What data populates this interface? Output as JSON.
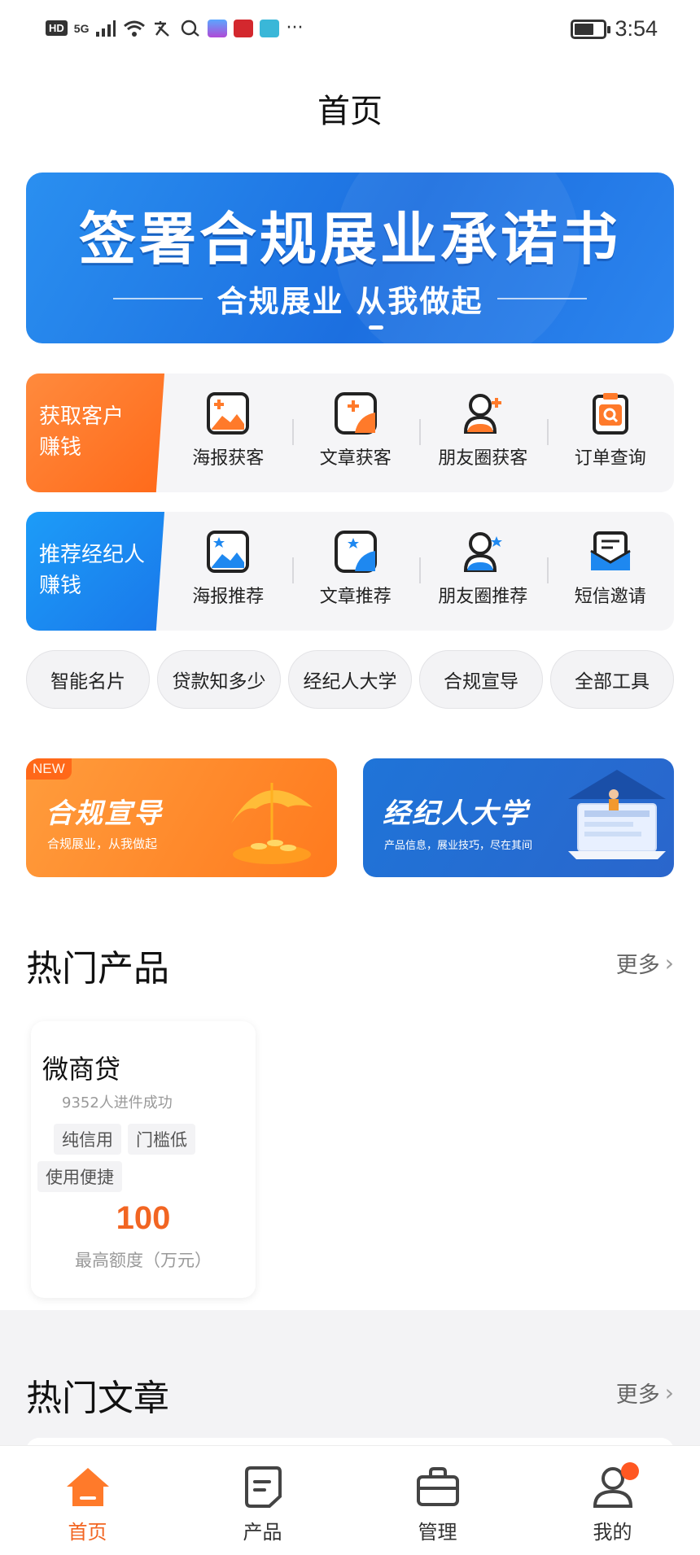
{
  "status_bar": {
    "hd": "HD",
    "network": "5G",
    "time": "3:54",
    "icons": [
      "signal-icon",
      "wifi-icon",
      "translate-icon",
      "chat-icon",
      "app-icon",
      "app-icon",
      "app-icon",
      "more-icon"
    ]
  },
  "nav": {
    "title": "首页"
  },
  "banner": {
    "title": "签署合规展业承诺书",
    "subtitle": "合规展业 从我做起"
  },
  "acquire_row": {
    "label_line1": "获取客户",
    "label_line2": "赚钱",
    "items": [
      {
        "label": "海报获客",
        "icon": "poster-icon"
      },
      {
        "label": "文章获客",
        "icon": "article-icon"
      },
      {
        "label": "朋友圈获客",
        "icon": "moments-icon"
      },
      {
        "label": "订单查询",
        "icon": "order-search-icon"
      }
    ]
  },
  "recommend_row": {
    "label_line1": "推荐经纪人",
    "label_line2": "赚钱",
    "items": [
      {
        "label": "海报推荐",
        "icon": "poster-icon"
      },
      {
        "label": "文章推荐",
        "icon": "article-icon"
      },
      {
        "label": "朋友圈推荐",
        "icon": "moments-icon"
      },
      {
        "label": "短信邀请",
        "icon": "sms-icon"
      }
    ]
  },
  "chips": [
    "智能名片",
    "贷款知多少",
    "经纪人大学",
    "合规宣导",
    "全部工具"
  ],
  "promos": {
    "compliance": {
      "tag": "NEW",
      "title": "合规宣导",
      "subtitle": "合规展业，从我做起"
    },
    "university": {
      "title": "经纪人大学",
      "subtitle": "产品信息，展业技巧，尽在其间"
    }
  },
  "hot_products": {
    "title": "热门产品",
    "more": "更多",
    "items": [
      {
        "name": "微商贷",
        "stat": "9352人进件成功",
        "tags": [
          "纯信用",
          "门槛低",
          "使用便捷"
        ],
        "max_value": "100",
        "max_label": "最高额度（万元）"
      }
    ]
  },
  "hot_articles": {
    "title": "热门文章",
    "more": "更多"
  },
  "tabs": [
    {
      "label": "首页",
      "active": true
    },
    {
      "label": "产品",
      "active": false
    },
    {
      "label": "管理",
      "active": false
    },
    {
      "label": "我的",
      "active": false
    }
  ],
  "colors": {
    "accent_orange": "#f26522",
    "accent_blue": "#1c78e8",
    "background": "#ffffff"
  }
}
